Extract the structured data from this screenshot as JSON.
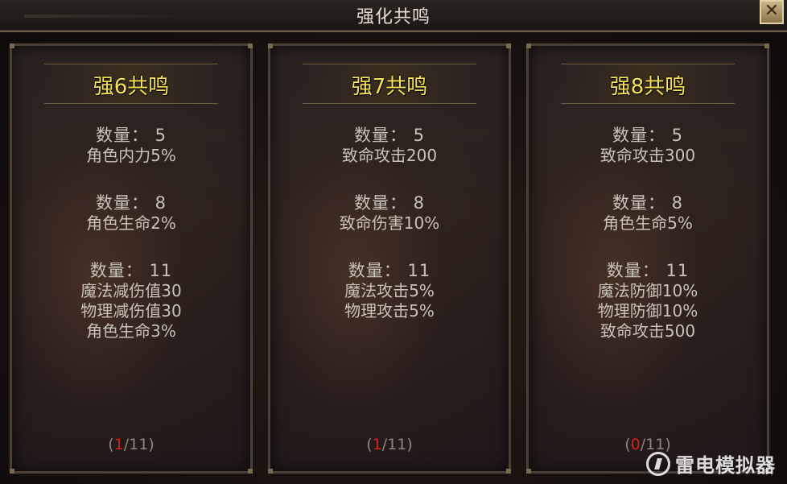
{
  "window": {
    "title": "强化共鸣",
    "close_label": "✕"
  },
  "cards": [
    {
      "header": "强6共鸣",
      "groups": [
        {
          "qty": "数量： 5",
          "attrs": [
            "角色内力5%"
          ]
        },
        {
          "qty": "数量： 8",
          "attrs": [
            "角色生命2%"
          ]
        },
        {
          "qty": "数量： 11",
          "attrs": [
            "魔法减伤值30",
            "物理减伤值30",
            "角色生命3%"
          ]
        }
      ],
      "progress": {
        "open": "(",
        "current": "1",
        "total": "/11)"
      }
    },
    {
      "header": "强7共鸣",
      "groups": [
        {
          "qty": "数量： 5",
          "attrs": [
            "致命攻击200"
          ]
        },
        {
          "qty": "数量： 8",
          "attrs": [
            "致命伤害10%"
          ]
        },
        {
          "qty": "数量： 11",
          "attrs": [
            "魔法攻击5%",
            "物理攻击5%"
          ]
        }
      ],
      "progress": {
        "open": "(",
        "current": "1",
        "total": "/11)"
      }
    },
    {
      "header": "强8共鸣",
      "groups": [
        {
          "qty": "数量： 5",
          "attrs": [
            "致命攻击300"
          ]
        },
        {
          "qty": "数量： 8",
          "attrs": [
            "角色生命5%"
          ]
        },
        {
          "qty": "数量： 11",
          "attrs": [
            "魔法防御10%",
            "物理防御10%",
            "致命攻击500"
          ]
        }
      ],
      "progress": {
        "open": "(",
        "current": "0",
        "total": "/11)"
      }
    }
  ],
  "watermark": {
    "text": "雷电模拟器"
  }
}
